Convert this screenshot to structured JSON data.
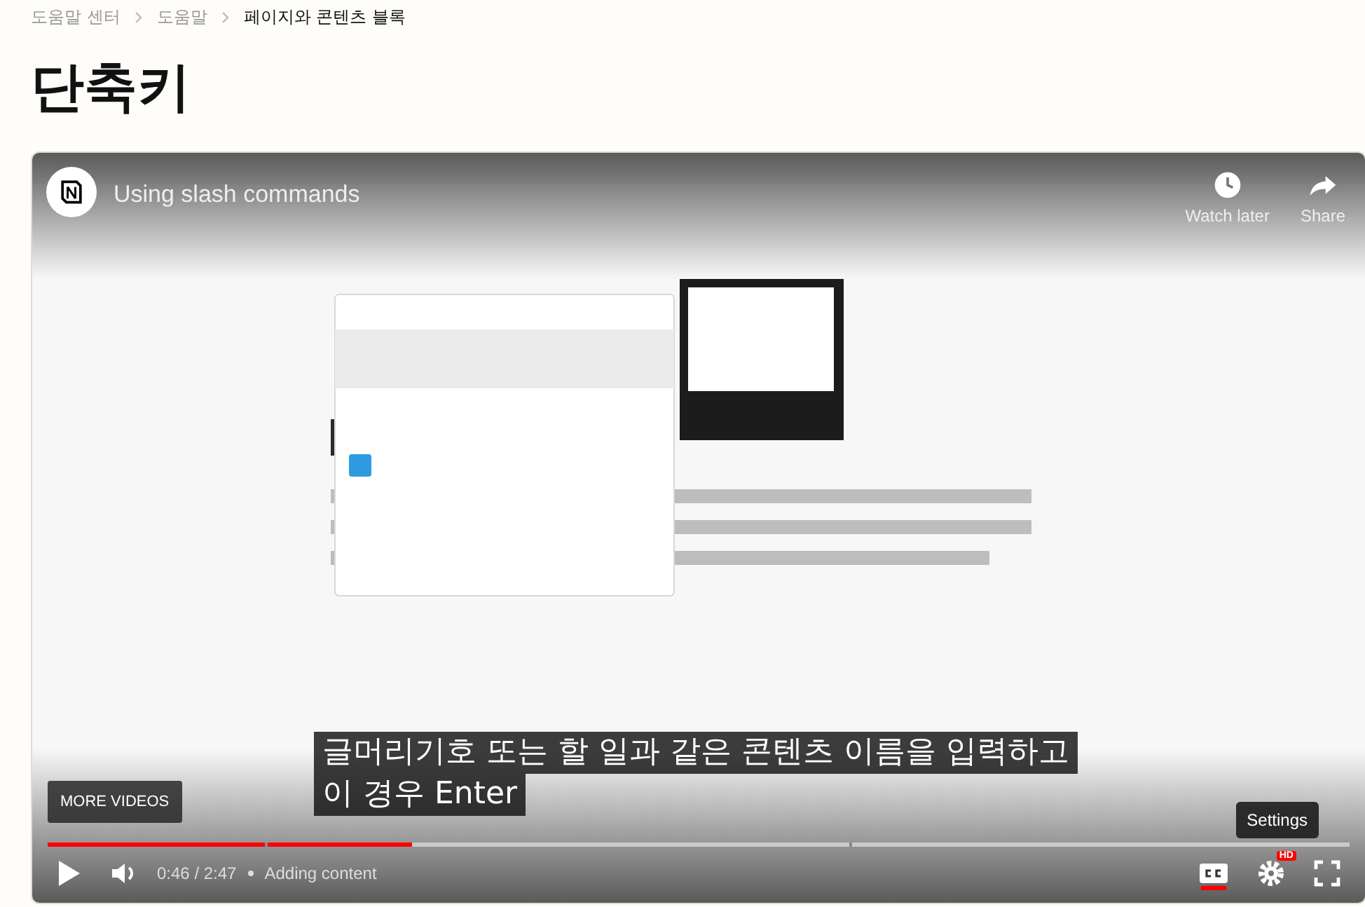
{
  "breadcrumb": [
    {
      "label": "도움말 센터",
      "current": false
    },
    {
      "label": "도움말",
      "current": false
    },
    {
      "label": "페이지와 콘텐츠 블록",
      "current": true
    }
  ],
  "heading": "단축키",
  "player": {
    "title": "Using slash commands",
    "watch_later": "Watch later",
    "share": "Share",
    "subtitle_lines": [
      "글머리기호 또는 할 일과 같은 콘텐츠 이름을 입력하고",
      "이 경우 Enter"
    ],
    "more_videos": "MORE VIDEOS",
    "tooltip": "Settings",
    "level": 0.28,
    "time": "0:46 / 2:47",
    "chapter": "Adding content",
    "captions_on": true,
    "quality_badge": "HD"
  }
}
